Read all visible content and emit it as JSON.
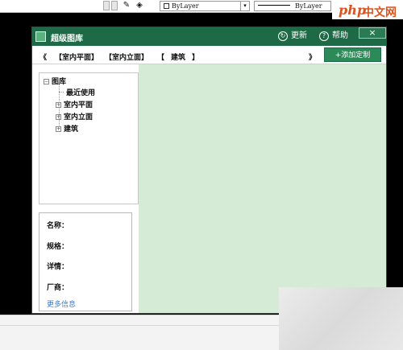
{
  "toolbar": {
    "layer_combo1": "ByLayer",
    "layer_combo2": "ByLayer"
  },
  "dialog": {
    "title": "超级图库",
    "refresh": "更新",
    "help": "帮助",
    "close": "×"
  },
  "tabs": {
    "prev": "《",
    "next": "》",
    "items": [
      "【室内平面】",
      "【室内立面】",
      "【",
      "建筑",
      "】"
    ],
    "add_button": "+添加定制"
  },
  "tree": {
    "root": "图库",
    "children": [
      "最近使用",
      "室内平面",
      "室内立面",
      "建筑"
    ]
  },
  "info": {
    "name_label": "名称：",
    "spec_label": "规格：",
    "detail_label": "详情：",
    "vendor_label": "厂商：",
    "more_link": "更多信息"
  },
  "brand": {
    "logo_latin": "php",
    "logo_cn": "中文网"
  }
}
